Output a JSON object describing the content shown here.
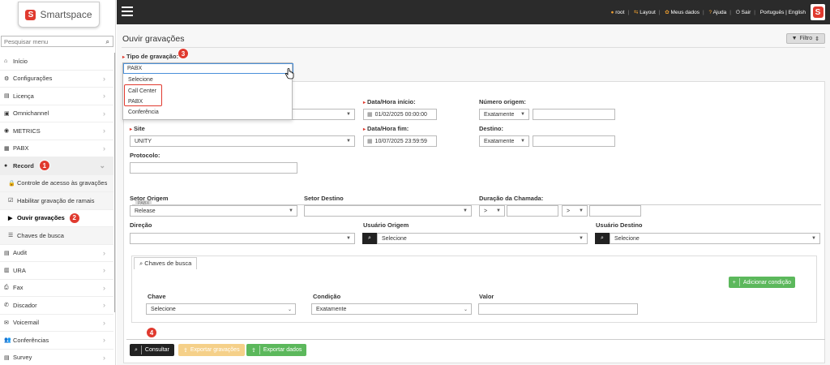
{
  "brand": {
    "name": "Smartspace",
    "mark": "S"
  },
  "sidebar": {
    "search_placeholder": "Pesquisar menu",
    "items": [
      {
        "icon": "home-icon",
        "glyph": "⌂",
        "label": "Início"
      },
      {
        "icon": "gears-icon",
        "glyph": "⚙",
        "label": "Configurações"
      },
      {
        "icon": "license-icon",
        "glyph": "▤",
        "label": "Licença"
      },
      {
        "icon": "omnichannel-icon",
        "glyph": "▣",
        "label": "Omnichannel"
      },
      {
        "icon": "metrics-icon",
        "glyph": "◉",
        "label": "METRICS"
      },
      {
        "icon": "pabx-icon",
        "glyph": "▦",
        "label": "PABX"
      },
      {
        "icon": "record-icon",
        "glyph": "●",
        "label": "Record"
      }
    ],
    "record_sub": [
      {
        "icon": "lock-icon",
        "glyph": "🔒",
        "label": "Controle de acesso às gravações"
      },
      {
        "icon": "checkbox-icon",
        "glyph": "☑",
        "label": "Habilitar gravação de ramais"
      },
      {
        "icon": "play-icon",
        "glyph": "▶",
        "label": "Ouvir gravações"
      },
      {
        "icon": "list-icon",
        "glyph": "☰",
        "label": "Chaves de busca"
      }
    ],
    "items_after": [
      {
        "icon": "audit-icon",
        "glyph": "▤",
        "label": "Audit"
      },
      {
        "icon": "ura-icon",
        "glyph": "▥",
        "label": "URA"
      },
      {
        "icon": "fax-icon",
        "glyph": "⎙",
        "label": "Fax"
      },
      {
        "icon": "phone-icon",
        "glyph": "✆",
        "label": "Discador"
      },
      {
        "icon": "voicemail-icon",
        "glyph": "✉",
        "label": "Voicemail"
      },
      {
        "icon": "users-icon",
        "glyph": "👥",
        "label": "Conferências"
      },
      {
        "icon": "survey-icon",
        "glyph": "▤",
        "label": "Survey"
      }
    ]
  },
  "topbar": {
    "user": "root",
    "layout": "Layout",
    "my_data": "Meus dados",
    "help": "Ajuda",
    "logout": "Sair",
    "languages": "Português | English"
  },
  "page": {
    "title": "Ouvir gravações",
    "filter_button": "Filtro"
  },
  "form": {
    "tipo_label": "Tipo de gravação:",
    "tipo_value": "PABX",
    "tipo_options": [
      "Selecione",
      "Call Center",
      "PABX",
      "Conferência"
    ],
    "dh_inicio_label": "Data/Hora início:",
    "dh_inicio_value": "01/02/2025 00:00:00",
    "num_origem_label": "Número origem:",
    "num_origem_cond": "Exatamente",
    "site_label": "Site",
    "site_value": "UNITY",
    "dh_fim_label": "Data/Hora fim:",
    "dh_fim_value": "10/07/2025 23:59:59",
    "destino_label": "Destino:",
    "destino_cond": "Exatamente",
    "protocolo_label": "Protocolo:",
    "pabx_tag": "PABX",
    "setor_origem_label": "Setor Origem",
    "setor_origem_value": "Release",
    "setor_destino_label": "Setor Destino",
    "duracao_label": "Duração da Chamada:",
    "duracao_op1": ">",
    "duracao_op2": ">",
    "direcao_label": "Direção",
    "usuario_origem_label": "Usuário Origem",
    "usuario_origem_value": "Selecione",
    "usuario_destino_label": "Usuário Destino",
    "usuario_destino_value": "Selecione"
  },
  "keys": {
    "tab": "Chaves de busca",
    "add_button": "Adicionar condição",
    "chave_label": "Chave",
    "chave_value": "Selecione",
    "condicao_label": "Condição",
    "condicao_value": "Exatamente",
    "valor_label": "Valor"
  },
  "actions": {
    "consultar": "Consultar",
    "exportar_gravacoes": "Exportar gravações",
    "exportar_dados": "Exportar dados"
  },
  "badges": [
    "1",
    "2",
    "3",
    "4"
  ],
  "colors": {
    "accent": "#e03a2f",
    "topbar": "#2b2b2b",
    "green": "#5cb85c",
    "yellow": "#f5d089"
  }
}
